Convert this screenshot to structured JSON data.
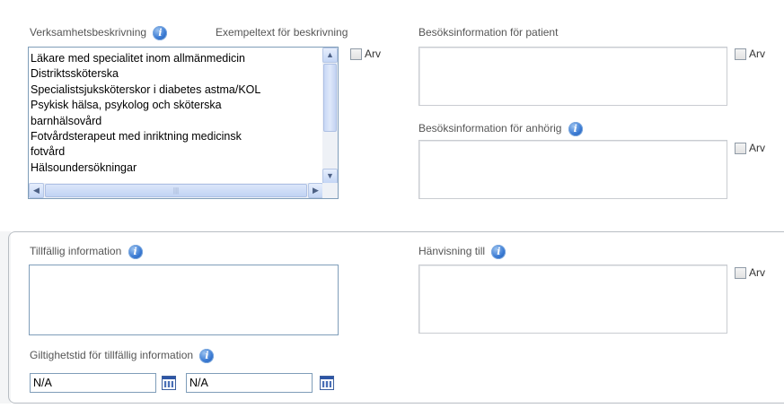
{
  "verksamhet": {
    "label": "Verksamhetsbeskrivning",
    "example_link": "Exempeltext för beskrivning",
    "items": [
      "Läkare med specialitet inom allmänmedicin",
      "Distriktssköterska",
      "Specialistsjuksköterskor i diabetes astma/KOL",
      "Psykisk hälsa, psykolog och sköterska",
      "barnhälsovård",
      "Fotvårdsterapeut med inriktning medicinsk",
      "fotvård",
      "Hälsoundersökningar"
    ]
  },
  "arv_label": "Arv",
  "besok_patient": {
    "label": "Besöksinformation för patient"
  },
  "besok_anhorig": {
    "label": "Besöksinformation för anhörig"
  },
  "tillfallig": {
    "label": "Tillfällig information"
  },
  "hanvisning": {
    "label": "Hänvisning till"
  },
  "giltighet": {
    "label": "Giltighetstid för tillfällig information",
    "from_value": "N/A",
    "to_value": "N/A"
  },
  "icons": {
    "info": "info-icon",
    "calendar": "calendar-icon"
  },
  "colors": {
    "info_icon": "#3b7bd4",
    "border": "#a5acb5",
    "input_border": "#7f9db9"
  }
}
